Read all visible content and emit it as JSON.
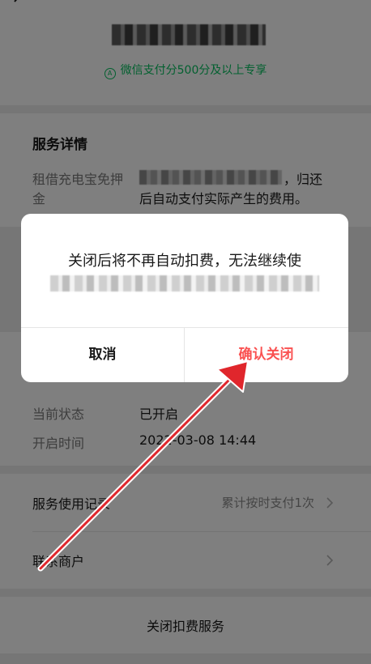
{
  "header": {
    "payscore_tag": "微信支付分500分及以上专享"
  },
  "details": {
    "title": "服务详情",
    "label": "租借充电宝免押金",
    "comma": "，归还",
    "line2": "后自动支付实际产生的费用。"
  },
  "status": {
    "state_label": "当前状态",
    "state_value": "已开启",
    "time_label": "开启时间",
    "time_value": "2022-03-08 14:44"
  },
  "menu": {
    "records_label": "服务使用记录",
    "records_value": "累计按时支付1次",
    "contact_label": "联系商户"
  },
  "bottom": {
    "close_label": "关闭扣费服务"
  },
  "dialog": {
    "message": "关闭后将不再自动扣费，无法继续使",
    "cancel_label": "取消",
    "confirm_label": "确认关闭"
  },
  "colors": {
    "brand_green": "#07c160",
    "danger_red": "#fa5151",
    "annotation_red": "#e0262c"
  }
}
